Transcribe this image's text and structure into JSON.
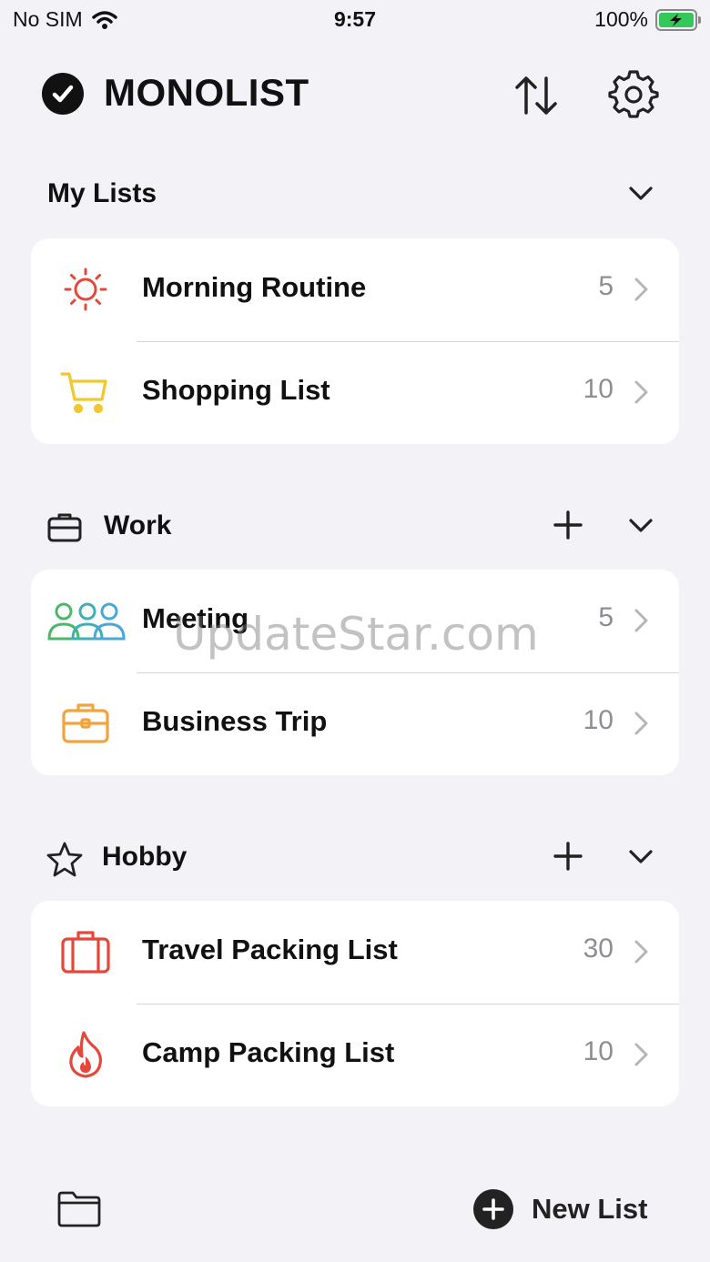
{
  "status_bar": {
    "carrier": "No SIM",
    "time": "9:57",
    "battery": "100%"
  },
  "app": {
    "title": "MONOLIST"
  },
  "sections": [
    {
      "title": "My Lists",
      "items": [
        {
          "label": "Morning Routine",
          "count": "5",
          "icon": "sun-icon",
          "color": "#e5483b"
        },
        {
          "label": "Shopping List",
          "count": "10",
          "icon": "cart-icon",
          "color": "#f3c82e"
        }
      ]
    },
    {
      "title": "Work",
      "items": [
        {
          "label": "Meeting",
          "count": "5",
          "icon": "people-icon",
          "color": "#4cb86a"
        },
        {
          "label": "Business Trip",
          "count": "10",
          "icon": "briefcase-icon",
          "color": "#f2a33c"
        }
      ]
    },
    {
      "title": "Hobby",
      "items": [
        {
          "label": "Travel Packing List",
          "count": "30",
          "icon": "suitcase-icon",
          "color": "#e5483b"
        },
        {
          "label": "Camp Packing List",
          "count": "10",
          "icon": "flame-icon",
          "color": "#e5483b"
        }
      ]
    }
  ],
  "footer": {
    "new_list_label": "New List"
  },
  "watermark": "UpdateStar.com"
}
